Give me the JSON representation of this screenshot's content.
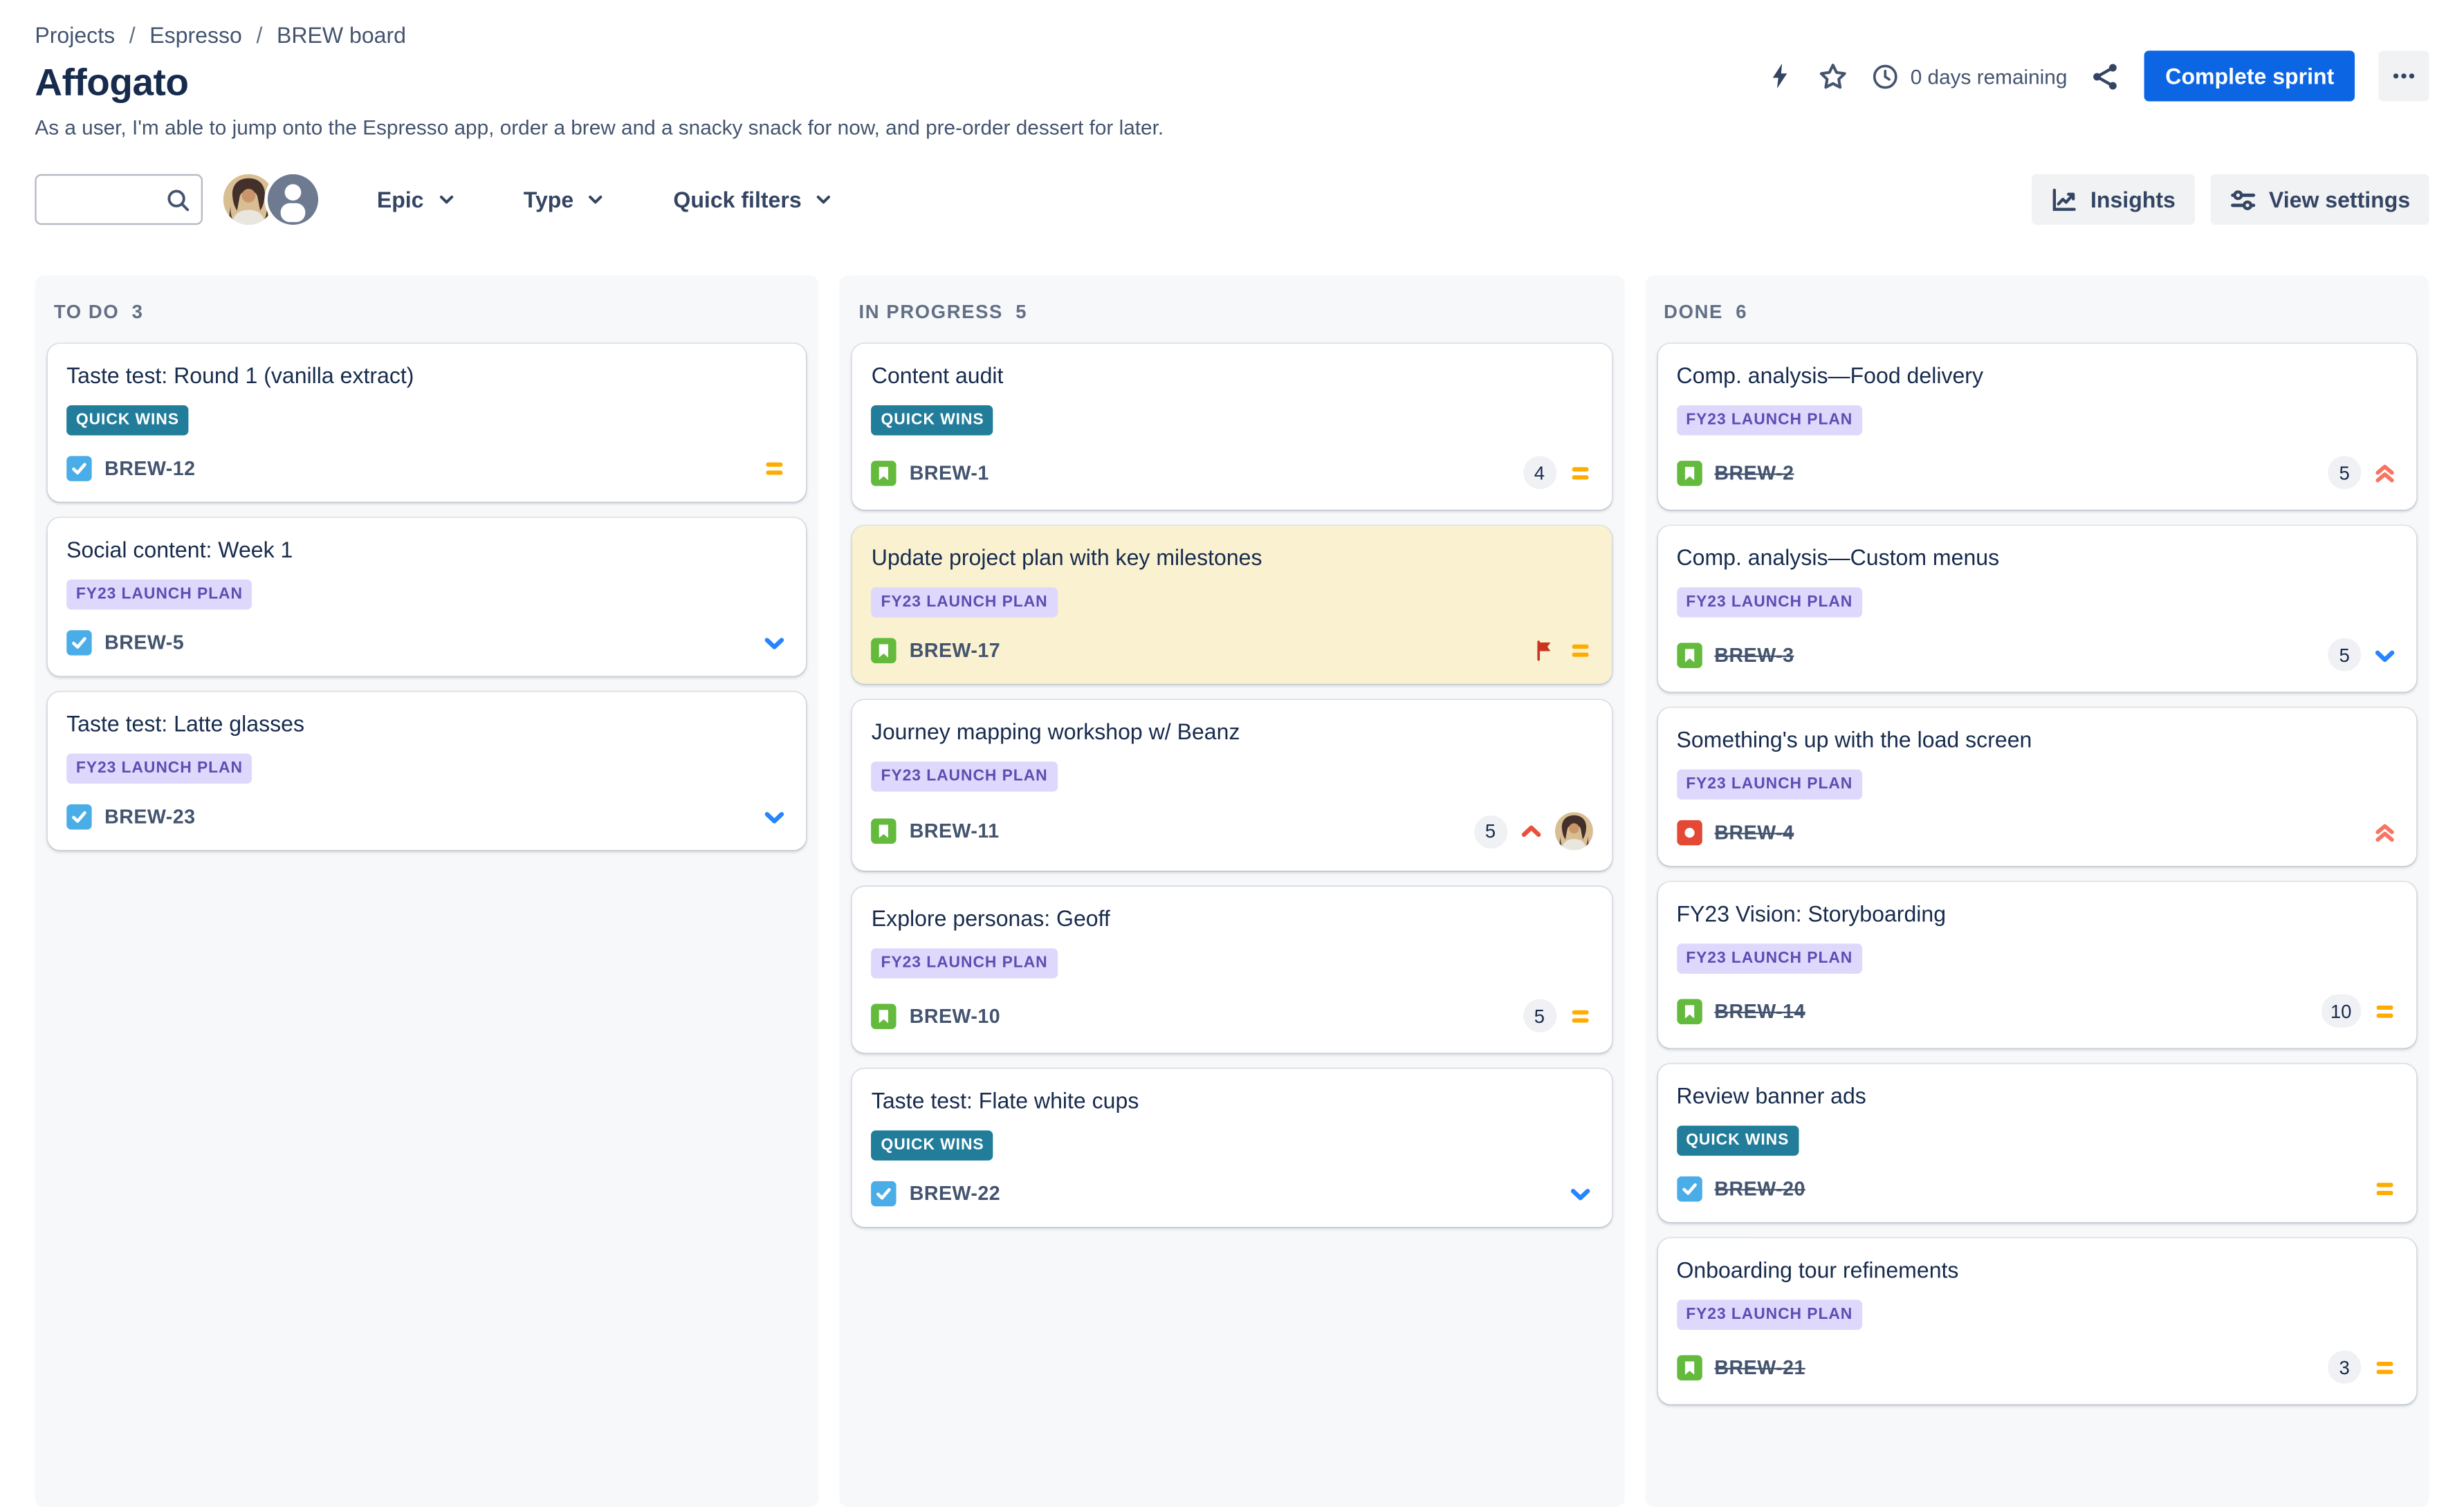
{
  "breadcrumb": {
    "separator": "/",
    "items": [
      "Projects",
      "Espresso",
      "BREW board"
    ]
  },
  "header": {
    "title": "Affogato",
    "subtitle": "As a user, I'm able to jump onto the Espresso app, order a brew and a snacky snack for now, and pre-order dessert for later.",
    "days_remaining": "0 days remaining",
    "complete_sprint_label": "Complete sprint"
  },
  "toolbar": {
    "search_value": "",
    "search_placeholder": "",
    "filters": [
      {
        "label": "Epic"
      },
      {
        "label": "Type"
      },
      {
        "label": "Quick filters"
      }
    ],
    "insights_label": "Insights",
    "view_settings_label": "View settings"
  },
  "icons": {
    "lightning-icon": "sprint lightning bolt",
    "star-icon": "favorite star outline",
    "clock-icon": "time remaining clock",
    "share-icon": "share nodes",
    "more-icon": "three dots menu",
    "search-icon": "magnifier",
    "chevron-down-icon": "dropdown chevron",
    "insights-chart-icon": "line chart",
    "view-settings-sliders-icon": "settings sliders",
    "task-icon": "blue square white check",
    "story-icon": "green square white bookmark",
    "bug-icon": "red square white circle",
    "priority-medium-icon": "orange equals bars",
    "priority-low-icon": "blue chevron down",
    "priority-high-icon": "red chevron up",
    "priority-highest-icon": "red double chevron up",
    "flag-icon": "red flag",
    "user-avatar": "photo of team member",
    "generic-avatar": "gray person silhouette"
  },
  "colors": {
    "accent_blue": "#0C66E4",
    "column_bg": "#F7F8F9",
    "epic_teal_bg": "#227D9B",
    "epic_purple_bg": "#DFD8FD",
    "epic_purple_text": "#5E4DB2",
    "priority_medium": "#FFAB00",
    "priority_low": "#2684FF",
    "priority_high": "#E8503F",
    "priority_highest": "#F87462",
    "flag_red": "#CA3521",
    "type_task": "#4BADE8",
    "type_story": "#63BA3C",
    "type_bug": "#E34935",
    "card_highlight_bg": "#F9F1D0"
  },
  "board": {
    "columns": [
      {
        "name": "TO DO",
        "count": 3,
        "cards": [
          {
            "title": "Taste test: Round 1 (vanilla extract)",
            "epic": "QUICK WINS",
            "epic_color": "teal",
            "type": "task",
            "key": "BREW-12",
            "done": false,
            "points": null,
            "priority": "medium",
            "flagged": false,
            "highlighted": false,
            "assignee": null
          },
          {
            "title": "Social content: Week 1",
            "epic": "FY23 LAUNCH PLAN",
            "epic_color": "purple",
            "type": "task",
            "key": "BREW-5",
            "done": false,
            "points": null,
            "priority": "low",
            "flagged": false,
            "highlighted": false,
            "assignee": null
          },
          {
            "title": "Taste test: Latte glasses",
            "epic": "FY23 LAUNCH PLAN",
            "epic_color": "purple",
            "type": "task",
            "key": "BREW-23",
            "done": false,
            "points": null,
            "priority": "low",
            "flagged": false,
            "highlighted": false,
            "assignee": null
          }
        ]
      },
      {
        "name": "IN PROGRESS",
        "count": 5,
        "cards": [
          {
            "title": "Content audit",
            "epic": "QUICK WINS",
            "epic_color": "teal",
            "type": "story",
            "key": "BREW-1",
            "done": false,
            "points": 4,
            "priority": "medium",
            "flagged": false,
            "highlighted": false,
            "assignee": null
          },
          {
            "title": "Update project plan with key milestones",
            "epic": "FY23 LAUNCH PLAN",
            "epic_color": "purple",
            "type": "story",
            "key": "BREW-17",
            "done": false,
            "points": null,
            "priority": "medium",
            "flagged": true,
            "highlighted": true,
            "assignee": null
          },
          {
            "title": "Journey mapping workshop w/ Beanz",
            "epic": "FY23 LAUNCH PLAN",
            "epic_color": "purple",
            "type": "story",
            "key": "BREW-11",
            "done": false,
            "points": 5,
            "priority": "high",
            "flagged": false,
            "highlighted": false,
            "assignee": "user-avatar"
          },
          {
            "title": "Explore personas: Geoff",
            "epic": "FY23 LAUNCH PLAN",
            "epic_color": "purple",
            "type": "story",
            "key": "BREW-10",
            "done": false,
            "points": 5,
            "priority": "medium",
            "flagged": false,
            "highlighted": false,
            "assignee": null
          },
          {
            "title": "Taste test: Flate white cups",
            "epic": "QUICK WINS",
            "epic_color": "teal",
            "type": "task",
            "key": "BREW-22",
            "done": false,
            "points": null,
            "priority": "low",
            "flagged": false,
            "highlighted": false,
            "assignee": null
          }
        ]
      },
      {
        "name": "DONE",
        "count": 6,
        "cards": [
          {
            "title": "Comp. analysis—Food delivery",
            "epic": "FY23 LAUNCH PLAN",
            "epic_color": "purple",
            "type": "story",
            "key": "BREW-2",
            "done": true,
            "points": 5,
            "priority": "highest",
            "flagged": false,
            "highlighted": false,
            "assignee": null
          },
          {
            "title": "Comp. analysis—Custom menus",
            "epic": "FY23 LAUNCH PLAN",
            "epic_color": "purple",
            "type": "story",
            "key": "BREW-3",
            "done": true,
            "points": 5,
            "priority": "low",
            "flagged": false,
            "highlighted": false,
            "assignee": null
          },
          {
            "title": "Something's up with the load screen",
            "epic": "FY23 LAUNCH PLAN",
            "epic_color": "purple",
            "type": "bug",
            "key": "BREW-4",
            "done": true,
            "points": null,
            "priority": "highest",
            "flagged": false,
            "highlighted": false,
            "assignee": null
          },
          {
            "title": "FY23 Vision: Storyboarding",
            "epic": "FY23 LAUNCH PLAN",
            "epic_color": "purple",
            "type": "story",
            "key": "BREW-14",
            "done": true,
            "points": 10,
            "priority": "medium",
            "flagged": false,
            "highlighted": false,
            "assignee": null
          },
          {
            "title": "Review banner ads",
            "epic": "QUICK WINS",
            "epic_color": "teal",
            "type": "task",
            "key": "BREW-20",
            "done": true,
            "points": null,
            "priority": "medium",
            "flagged": false,
            "highlighted": false,
            "assignee": null
          },
          {
            "title": "Onboarding tour refinements",
            "epic": "FY23 LAUNCH PLAN",
            "epic_color": "purple",
            "type": "story",
            "key": "BREW-21",
            "done": true,
            "points": 3,
            "priority": "medium",
            "flagged": false,
            "highlighted": false,
            "assignee": null
          }
        ]
      }
    ]
  }
}
